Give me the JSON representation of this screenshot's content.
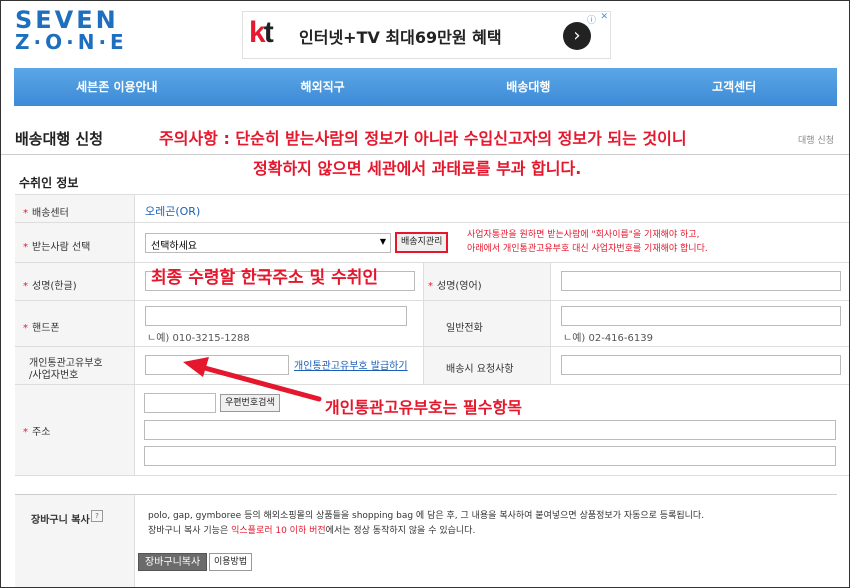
{
  "logo": {
    "line1": "SEVEN",
    "line2": "Z·O·N·E"
  },
  "ad": {
    "brand_k": "k",
    "brand_t": "t",
    "text": "인터넷+TV 최대69만원 혜택",
    "arrow": "›",
    "info": "ⓘ",
    "close": "✕"
  },
  "nav": {
    "items": [
      "세븐존 이용안내",
      "해외직구",
      "배송대행",
      "고객센터"
    ]
  },
  "page": {
    "title": "배송대행 신청",
    "breadcrumb": "대행 신청"
  },
  "warning": {
    "line1": "주의사항 : 단순히 받는사람의 정보가 아니라 수입신고자의 정보가 되는 것이니",
    "line2": "정확하지 않으면 세관에서 과태료를 부과 합니다."
  },
  "section": {
    "title": "수취인 정보"
  },
  "form": {
    "required_mark": "*",
    "center": {
      "label": "배송센터",
      "value": "오레곤(OR)"
    },
    "recipient": {
      "label": "받는사람 선택",
      "select_value": "선택하세요",
      "select_arrow": "▼",
      "manage_button": "배송지관리",
      "note1": "사업자통관을 원하면 받는사람에 \"회사이름\"을 기재해야 하고,",
      "note2": "아래에서 개인통관고유부호 대신 사업자번호를 기재해야 합니다."
    },
    "name_kr": {
      "label": "성명(한글)"
    },
    "name_en": {
      "label": "성명(영어)"
    },
    "phone": {
      "label": "핸드폰",
      "hint": "ㄴ예) 010-3215-1288"
    },
    "tel": {
      "label": "일반전화",
      "hint": "ㄴ예) 02-416-6139"
    },
    "customs": {
      "label1": "개인통관고유부호",
      "label2": "/사업자번호",
      "link": "개인통관고유부호 발급하기"
    },
    "request": {
      "label": "배송시 요청사항"
    },
    "address": {
      "label": "주소",
      "zip_button": "우편번호검색"
    }
  },
  "annotations": {
    "korean_address": "최종 수령할 한국주소 및 수취인",
    "customs_required": "개인통관고유부호는 필수항목"
  },
  "cart": {
    "label": "장바구니 복사",
    "help": "?",
    "text1": "polo, gap, gymboree 등의 해외소핑몰의 상품들을 shopping bag 에 담은 후, 그 내용을 복사하여 붙여넣으면 상품정보가 자동으로 등록됩니다.",
    "text2_pre": "장바구니 복사 기능은 ",
    "text2_red": "익스플로러 10 이하 버전",
    "text2_post": "에서는 정상 동작하지 않을 수 있습니다.",
    "copy_button": "장바구니복사",
    "howto_button": "이용방법"
  },
  "colors": {
    "accent": "#3d8bd6",
    "warning": "#e5172c",
    "link": "#1b5fb8"
  }
}
